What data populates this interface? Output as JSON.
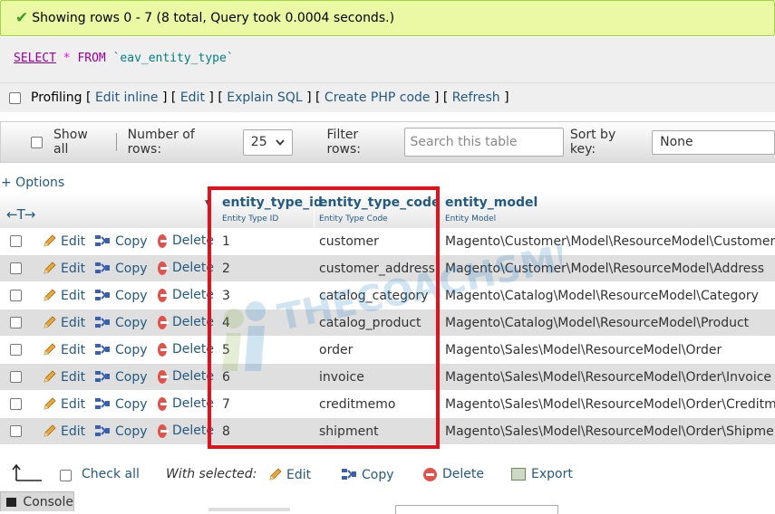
{
  "success": {
    "text": "Showing rows 0 - 7 (8 total, Query took 0.0004 seconds.)"
  },
  "sql": {
    "select": "SELECT",
    "star": "*",
    "from": "FROM",
    "table": "`eav_entity_type`"
  },
  "profiling": {
    "label": "Profiling",
    "links": [
      "Edit inline",
      "Edit",
      "Explain SQL",
      "Create PHP code",
      "Refresh"
    ]
  },
  "navbar": {
    "show_all": "Show all",
    "number_of_rows_label": "Number of rows:",
    "number_of_rows_value": "25",
    "filter_rows_label": "Filter rows:",
    "filter_placeholder": "Search this table",
    "sort_by_label": "Sort by key:",
    "sort_by_value": "None"
  },
  "options_link": "+ Options",
  "columns": [
    {
      "name": "entity_type_id",
      "comment": "Entity Type ID"
    },
    {
      "name": "entity_type_code",
      "comment": "Entity Type Code"
    },
    {
      "name": "entity_model",
      "comment": "Entity Model"
    }
  ],
  "actions": {
    "edit": "Edit",
    "copy": "Copy",
    "delete": "Delete"
  },
  "rows": [
    {
      "id": "1",
      "code": "customer",
      "model": "Magento\\Customer\\Model\\ResourceModel\\Customer"
    },
    {
      "id": "2",
      "code": "customer_address",
      "model": "Magento\\Customer\\Model\\ResourceModel\\Address"
    },
    {
      "id": "3",
      "code": "catalog_category",
      "model": "Magento\\Catalog\\Model\\ResourceModel\\Category"
    },
    {
      "id": "4",
      "code": "catalog_product",
      "model": "Magento\\Catalog\\Model\\ResourceModel\\Product"
    },
    {
      "id": "5",
      "code": "order",
      "model": "Magento\\Sales\\Model\\ResourceModel\\Order"
    },
    {
      "id": "6",
      "code": "invoice",
      "model": "Magento\\Sales\\Model\\ResourceModel\\Order\\Invoice"
    },
    {
      "id": "7",
      "code": "creditmemo",
      "model": "Magento\\Sales\\Model\\ResourceModel\\Order\\Creditmemo"
    },
    {
      "id": "8",
      "code": "shipment",
      "model": "Magento\\Sales\\Model\\ResourceModel\\Order\\Shipment"
    }
  ],
  "bottom": {
    "check_all": "Check all",
    "with_selected": "With selected:",
    "edit": "Edit",
    "copy": "Copy",
    "delete": "Delete",
    "export": "Export"
  },
  "console": "Console",
  "watermark": "THECOACHSMB",
  "colors": {
    "link": "#235a81",
    "highlight": "#e1121b",
    "success_bg": "#ebf8a4"
  }
}
